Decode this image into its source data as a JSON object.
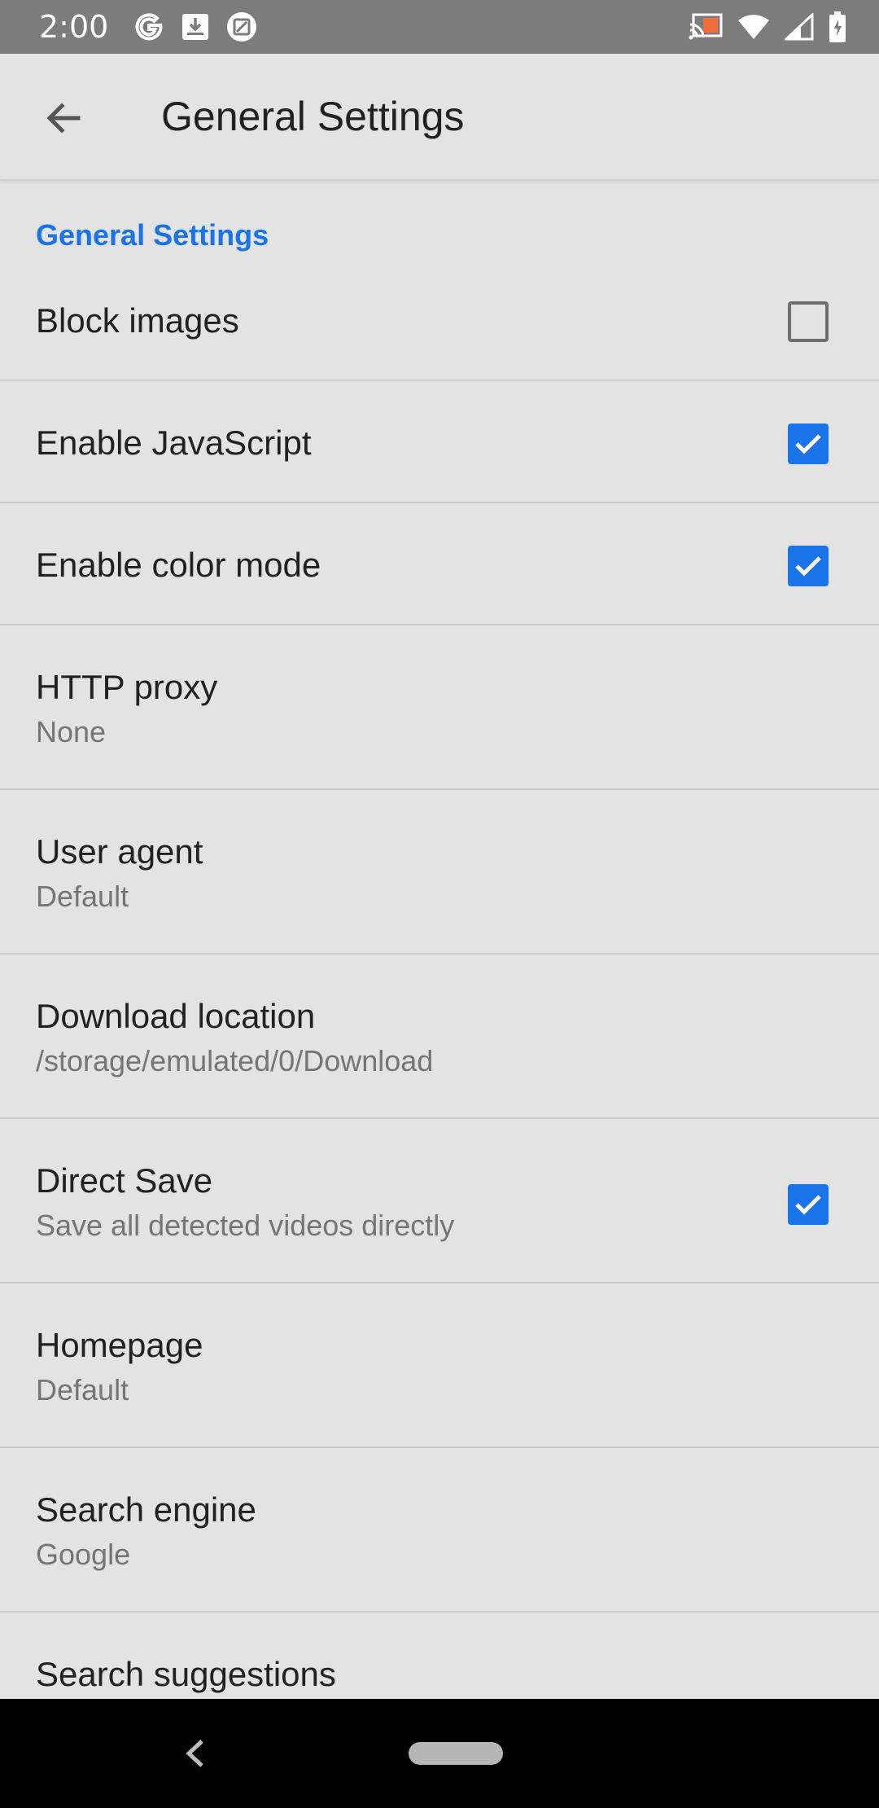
{
  "status": {
    "time": "2:00",
    "icons_left": [
      "google-icon",
      "download-icon",
      "screenshot-icon"
    ],
    "icons_right": [
      "cast-icon",
      "wifi-icon",
      "signal-icon",
      "battery-icon"
    ]
  },
  "appbar": {
    "title": "General Settings",
    "back_icon": "arrow-back-icon"
  },
  "section": {
    "header": "General Settings"
  },
  "settings": [
    {
      "title": "Block images",
      "checkbox": "unchecked"
    },
    {
      "title": "Enable JavaScript",
      "checkbox": "checked"
    },
    {
      "title": "Enable color mode",
      "checkbox": "checked"
    },
    {
      "title": "HTTP proxy",
      "subtitle": "None"
    },
    {
      "title": "User agent",
      "subtitle": "Default"
    },
    {
      "title": "Download location",
      "subtitle": "/storage/emulated/0/Download"
    },
    {
      "title": "Direct Save",
      "subtitle": "Save all detected videos directly",
      "checkbox": "checked"
    },
    {
      "title": "Homepage",
      "subtitle": "Default"
    },
    {
      "title": "Search engine",
      "subtitle": "Google"
    },
    {
      "title": "Search suggestions"
    }
  ],
  "colors": {
    "accent": "#1a73e8",
    "background": "#e3e3e3",
    "statusbar": "#7c7c7c",
    "navbar": "#000000"
  }
}
